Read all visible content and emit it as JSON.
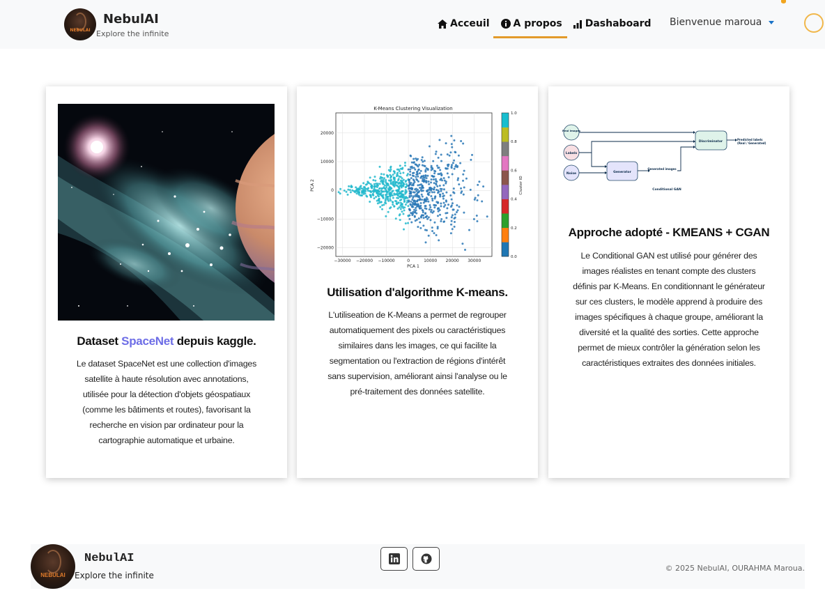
{
  "brand": {
    "name": "NebulAI",
    "tagline": "Explore the infinite",
    "logo_text": "NEBULAI"
  },
  "nav": {
    "items": [
      {
        "label": "Acceuil",
        "icon": "home-icon"
      },
      {
        "label": "A propos",
        "icon": "info-icon",
        "active": true
      },
      {
        "label": "Dashaboard",
        "icon": "bar-chart-icon"
      }
    ],
    "user_greeting": "Bienvenue maroua"
  },
  "colors": {
    "accent": "#e39a2a",
    "highlight": "#6d6de6",
    "navbar_bg": "#f8f9fa"
  },
  "cards": [
    {
      "title_prefix": "Dataset ",
      "title_highlight": "SpaceNet",
      "title_suffix": " depuis kaggle.",
      "image": "space-nebula-image",
      "text": "Le dataset SpaceNet est une collection d'images satellite à haute résolution avec annotations, utilisée pour la détection d'objets géospatiaux (comme les bâtiments et routes), favorisant la recherche en vision par ordinateur pour la cartographie automatique et urbaine."
    },
    {
      "title": "Utilisation d'algorithme K-means.",
      "image": "kmeans-scatter-plot",
      "text": "L'utiliseation de K-Means a permet de regrouper automatiquement des pixels ou caractéristiques similaires dans les images, ce qui facilite la segmentation ou l'extraction de régions d'intérêt sans supervision, améliorant ainsi l'analyse ou le pré-traitement des données satellite."
    },
    {
      "title": "Approche adopté - KMEANS + CGAN",
      "image": "cgan-diagram",
      "text": "Le Conditional GAN est utilisé pour générer des images réalistes en tenant compte des clusters définis par K-Means. En conditionnant le générateur sur ces clusters, le modèle apprend à produire des images spécifiques à chaque groupe, améliorant la diversité et la qualité des sorties. Cette approche permet de mieux contrôler la génération selon les caractéristiques extraites des données initiales."
    }
  ],
  "kmeans_plot": {
    "title": "K-Means Clustering Visualization",
    "xlabel": "PCA 1",
    "ylabel": "PCA 2",
    "colorbar_label": "Cluster ID",
    "xticks": [
      "−30000",
      "−20000",
      "−10000",
      "0",
      "10000",
      "20000",
      "30000"
    ],
    "yticks": [
      "20000",
      "10000",
      "0",
      "−10000",
      "−20000"
    ],
    "cbar_ticks": [
      "1.0",
      "0.8",
      "0.6",
      "0.4",
      "0.2",
      "0.0"
    ],
    "cbar_colors": [
      "#1f77b4",
      "#ff7f0e",
      "#2ca02c",
      "#d62728",
      "#9467bd",
      "#8c564b",
      "#e377c2",
      "#7f7f7f",
      "#bcbd22",
      "#17becf"
    ]
  },
  "cgan_diagram": {
    "real_images": "Real images",
    "labels": "Labels",
    "noise": "Noise",
    "generator": "Generator",
    "generated_images": "Generated images",
    "discriminator": "Discriminator",
    "predicted": "Predicted labels",
    "predicted_sub": "(Real / Generated)",
    "caption": "Conditional GAN"
  },
  "footer": {
    "name": "NebulAI",
    "tagline": "Explore the infinite",
    "copyright": "© 2025 NebulAI, OURAHMA Maroua.",
    "social": [
      "linkedin-icon",
      "github-icon"
    ]
  }
}
